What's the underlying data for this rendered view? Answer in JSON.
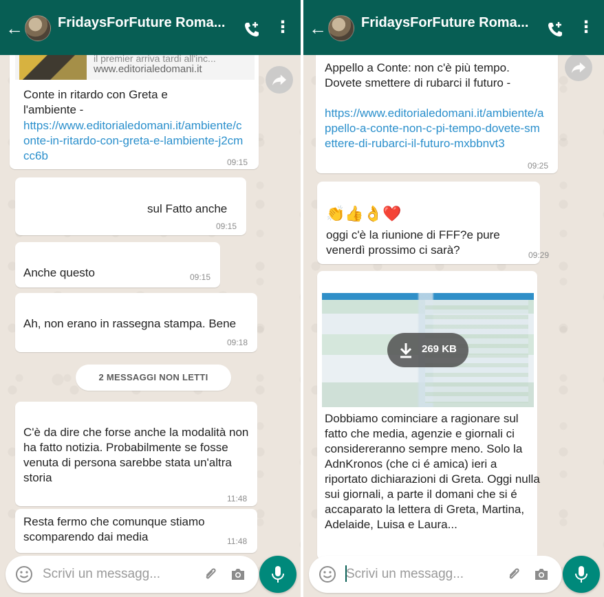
{
  "left": {
    "header": {
      "title": "FridaysForFuture Roma..."
    },
    "link_preview": {
      "snippet": "il premier arriva tardi all'inc...",
      "domain": "www.editorialedomani.it"
    },
    "messages": [
      {
        "text": "Conte in ritardo con Greta e l'ambiente -",
        "link": "https://www.editorialedomani.it/ambiente/conte-in-ritardo-con-greta-e-lambiente-j2cmcc6b",
        "time": "09:15"
      },
      {
        "text": "sul Fatto anche",
        "time": "09:15"
      },
      {
        "text": "Anche questo",
        "time": "09:15"
      },
      {
        "text": "Ah, non erano in rassegna stampa. Bene",
        "time": "09:18"
      },
      {
        "text": "C'è da dire che forse anche la modalità non ha fatto notizia. Probabilmente se fosse venuta di persona sarebbe stata un'altra storia",
        "time": "11:48"
      },
      {
        "text": "Resta fermo che comunque stiamo scomparendo dai media",
        "time": "11:48"
      }
    ],
    "unread_label": "2 MESSAGGI NON LETTI",
    "input": {
      "placeholder": "Scrivi un messagg..."
    }
  },
  "right": {
    "header": {
      "title": "FridaysForFuture Roma..."
    },
    "messages": [
      {
        "text": "Appello a Conte: non c'è più tempo. Dovete smettere di rubarci il futuro -",
        "link": "https://www.editorialedomani.it/ambiente/appello-a-conte-non-c-pi-tempo-dovete-smettere-di-rubarci-il-futuro-mxbbnvt3",
        "time": "09:25"
      },
      {
        "emoji": "👏👍👌❤️",
        "text": "oggi c'è la riunione di FFF?e pure venerdì prossimo ci sarà?",
        "time": "09:29"
      },
      {
        "media_size": "269 KB",
        "text": "Dobbiamo cominciare a ragionare sul fatto che media, agenzie e giornali ci considereranno sempre meno. Solo la AdnKronos (che ci é amica) ieri a riportato dichiarazioni di Greta. Oggi nulla sui giornali, a parte il domani che si é accaparato la lettera di Greta, Martina, Adelaide, Luisa e Laura..."
      }
    ],
    "input": {
      "placeholder": "Scrivi un messagg..."
    }
  },
  "icons": [
    "back-arrow-icon",
    "add-call-icon",
    "more-vert-icon",
    "share-forward-icon",
    "emoji-icon",
    "attach-clip-icon",
    "camera-icon",
    "mic-icon",
    "download-icon"
  ],
  "colors": {
    "header": "#075e54",
    "chat_bg": "#ece5dd",
    "link": "#2a8fcc",
    "mic": "#00897b"
  }
}
